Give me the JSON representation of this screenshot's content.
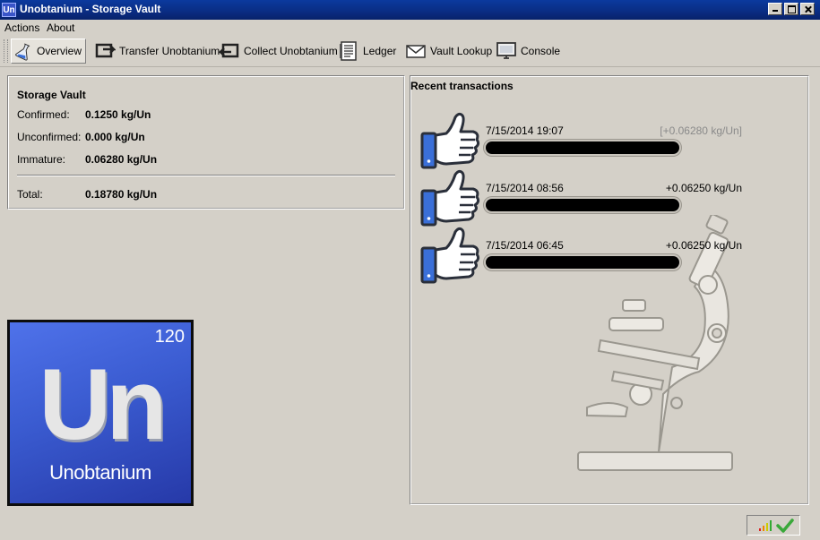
{
  "window": {
    "title": "Unobtanium - Storage Vault",
    "icon_text": "Un"
  },
  "menu": [
    "Actions",
    "About"
  ],
  "toolbar": [
    {
      "label": "Overview",
      "icon": "flask-icon",
      "active": true
    },
    {
      "label": "Transfer Unobtanium",
      "icon": "send-icon"
    },
    {
      "label": "Collect Unobtanium",
      "icon": "receive-icon"
    },
    {
      "label": "Ledger",
      "icon": "ledger-icon"
    },
    {
      "label": "Vault Lookup",
      "icon": "envelope-icon"
    },
    {
      "label": "Console",
      "icon": "monitor-icon"
    }
  ],
  "storage_vault": {
    "heading": "Storage Vault",
    "confirmed_label": "Confirmed:",
    "confirmed": "0.1250 kg/Un",
    "unconfirmed_label": "Unconfirmed:",
    "unconfirmed": "0.000 kg/Un",
    "immature_label": "Immature:",
    "immature": "0.06280 kg/Un",
    "total_label": "Total:",
    "total": "0.18780 kg/Un"
  },
  "logo": {
    "number": "120",
    "symbol": "Un",
    "name": "Unobtanium"
  },
  "recent": {
    "heading": "Recent transactions",
    "items": [
      {
        "date": "7/15/2014 19:07",
        "amount": "[+0.06280 kg/Un]",
        "pending": true
      },
      {
        "date": "7/15/2014 08:56",
        "amount": "+0.06250 kg/Un",
        "pending": false
      },
      {
        "date": "7/15/2014 06:45",
        "amount": "+0.06250 kg/Un",
        "pending": false
      }
    ]
  },
  "status": {
    "icons": [
      "signal-icon",
      "synced-check-icon"
    ]
  },
  "colors": {
    "titlebar": "#0a2c82",
    "logo_blue": "#3a5bd0",
    "thumb_blue": "#3a6fd8"
  }
}
